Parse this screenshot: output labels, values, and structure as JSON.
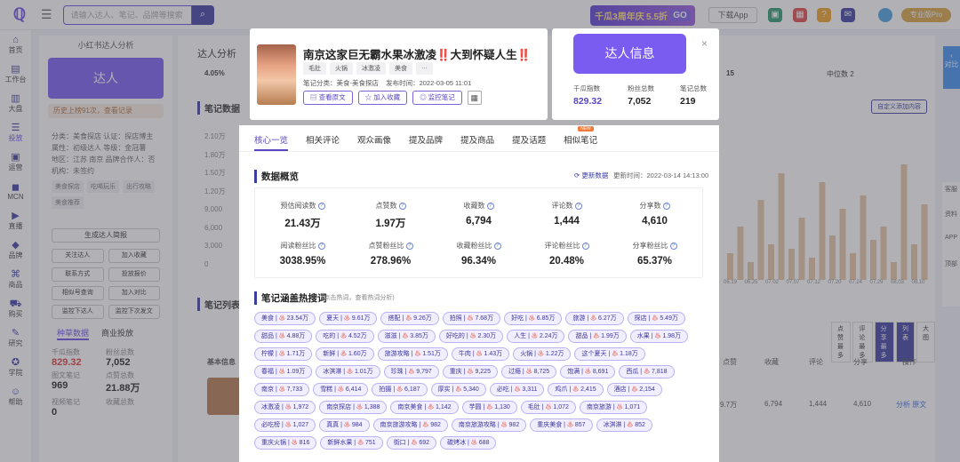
{
  "header": {
    "search_placeholder": "请输入达人、笔记、品牌等搜索",
    "banner_text": "千瓜3周年庆",
    "banner_discount": "5.5折",
    "banner_go": "GO",
    "download_app": "下载App",
    "vip_label": "专业版Pro"
  },
  "leftnav": [
    {
      "icon": "home-icon",
      "label": "首页"
    },
    {
      "icon": "workbench-icon",
      "label": "工作台"
    },
    {
      "icon": "market-icon",
      "label": "大盘"
    },
    {
      "icon": "rank-icon",
      "label": "投放"
    },
    {
      "icon": "ops-icon",
      "label": "运营"
    },
    {
      "icon": "mcn-icon",
      "label": "MCN"
    },
    {
      "icon": "live-icon",
      "label": "直播"
    },
    {
      "icon": "brand-icon",
      "label": "品牌"
    },
    {
      "icon": "product-icon",
      "label": "商品"
    },
    {
      "icon": "shop-icon",
      "label": "购买"
    },
    {
      "icon": "research-icon",
      "label": "研究"
    },
    {
      "icon": "school-icon",
      "label": "学院"
    },
    {
      "icon": "help-icon",
      "label": "帮助"
    }
  ],
  "sidepanel": {
    "title": "小红书达人分析",
    "daren": "达人",
    "history": "历史上榜91次，查看记录",
    "info_rows": [
      "分类：美食探店   认证：探店博主",
      "属性：初级达人   等级：金冠薯",
      "地区：江苏 南京   品牌合作人：否",
      "机构：未签约"
    ],
    "tags": [
      "美食探店",
      "吃喝玩乐",
      "出行攻略",
      "美食推荐"
    ],
    "actions": [
      "生成达人简报",
      "关注达人",
      "加入收藏",
      "联系方式",
      "投放报价",
      "相似号查询",
      "加入对比",
      "监控下达人",
      "监控下次发文"
    ],
    "tabs": [
      "种草数据",
      "商业投放"
    ],
    "stats": [
      {
        "label": "千瓜指数",
        "value": "829.32"
      },
      {
        "label": "粉丝总数",
        "value": "7,052"
      },
      {
        "label": "图文笔记",
        "value": "969"
      },
      {
        "label": "点赞总数",
        "value": "21.88万"
      },
      {
        "label": "视频笔记",
        "value": "0"
      },
      {
        "label": "收藏总数",
        "value": ""
      }
    ]
  },
  "background": {
    "title": "达人分析",
    "pct": "4.05%",
    "sec1": "笔记数据",
    "sec2": "笔记列表",
    "right_val1": "15",
    "right_val2": "中位数 2",
    "custom_btn": "自定义添加内容",
    "y_ticks": [
      "2.10万",
      "1.80万",
      "1.50万",
      "1.20万",
      "9,000",
      "6,000",
      "3,000",
      "0"
    ],
    "x_ticks": [
      "06.19",
      "06.25",
      "07.02",
      "07.07",
      "07.12",
      "07.20",
      "07.24",
      "07.29",
      "08.03",
      "08.10"
    ],
    "sort_labels": [
      "点赞最多",
      "评论最多",
      "分享最多",
      "列表",
      "大图"
    ],
    "row": {
      "likes": "9.7万",
      "collect": "6,794",
      "comments": "1,444",
      "share": "4,610",
      "ops": "分析 原文"
    },
    "table_heads": [
      "基本信息",
      "点赞",
      "收藏",
      "评论",
      "分享",
      "操作"
    ]
  },
  "note": {
    "title": "南京这家巨无霸水果冰激凌‼️大到怀疑人生‼️",
    "tags": [
      "毛肚",
      "火锅",
      "冰激凌",
      "美食",
      "…"
    ],
    "category": "笔记分类：美食-美食探店",
    "publish_time": "发布时间：2022-03-05 11:01",
    "btn_view": "查看原文",
    "btn_collect": "加入收藏",
    "btn_monitor": "监控笔记"
  },
  "daren_card": {
    "label": "达人信息",
    "stats": [
      {
        "label": "千瓜指数",
        "value": "829.32"
      },
      {
        "label": "粉丝总数",
        "value": "7,052"
      },
      {
        "label": "笔记总数",
        "value": "219"
      }
    ]
  },
  "tabs": [
    "核心一览",
    "相关评论",
    "观众画像",
    "提及品牌",
    "提及商品",
    "提及话题",
    "相似笔记"
  ],
  "new_badge": "NEW",
  "overview": {
    "title": "数据概览",
    "update": "更新数据",
    "update_time": "更新时间：2022-03-14 14:13:00",
    "row1": [
      {
        "label": "预估阅读数",
        "value": "21.43万"
      },
      {
        "label": "点赞数",
        "value": "1.97万"
      },
      {
        "label": "收藏数",
        "value": "6,794"
      },
      {
        "label": "评论数",
        "value": "1,444"
      },
      {
        "label": "分享数",
        "value": "4,610"
      }
    ],
    "row2": [
      {
        "label": "阅读粉丝比",
        "value": "3038.95%"
      },
      {
        "label": "点赞粉丝比",
        "value": "278.96%"
      },
      {
        "label": "收藏粉丝比",
        "value": "96.34%"
      },
      {
        "label": "评论粉丝比",
        "value": "20.48%"
      },
      {
        "label": "分享粉丝比",
        "value": "65.37%"
      }
    ]
  },
  "hotwords": {
    "title": "笔记涵盖热搜词",
    "sub": "(点击热词，查看热词分析)",
    "items": [
      "美食 | 23.54万",
      "夏天 | 9.61万",
      "搭配 | 9.26万",
      "拍照 | 7.68万",
      "好吃 | 6.85万",
      "旅游 | 6.27万",
      "探店 | 5.49万",
      "甜品 | 4.88万",
      "吃的 | 4.52万",
      "滋滋 | 3.85万",
      "好吃的 | 2.30万",
      "人生 | 2.24万",
      "甜品 | 1.99万",
      "水果 | 1.98万",
      "柠檬 | 1.71万",
      "新鲜 | 1.60万",
      "旅游攻略 | 1.51万",
      "牛肉 | 1.43万",
      "火锅 | 1.22万",
      "这个夏天 | 1.18万",
      "春福 | 1.09万",
      "冰淇淋 | 1.01万",
      "珍珠 | 9,797",
      "重庆 | 9,225",
      "过瘾 | 8,725",
      "饱满 | 8,691",
      "西瓜 | 7,818",
      "南京 | 7,733",
      "雪糕 | 6,414",
      "拍摄 | 6,187",
      "厚实 | 5,340",
      "必吃 | 3,311",
      "鸡爪 | 2,415",
      "酒店 | 2,154",
      "冰激凌 | 1,972",
      "南京探店 | 1,388",
      "南京美食 | 1,142",
      "芋圆 | 1,130",
      "毛肚 | 1,072",
      "南京旅游 | 1,071",
      "必吃榜 | 1,027",
      "真真 | 984",
      "南京旅游攻略 | 982",
      "南京旅游攻略 | 982",
      "重庆美食 | 857",
      "冰淇淋 | 852",
      "重庆火锅 | 816",
      "新鲜水果 | 751",
      "街口 | 692",
      "碳烤冰 | 688"
    ]
  },
  "right_rail": {
    "compare": "对比",
    "items": [
      "客服",
      "资料",
      "APP",
      "顶部"
    ]
  }
}
